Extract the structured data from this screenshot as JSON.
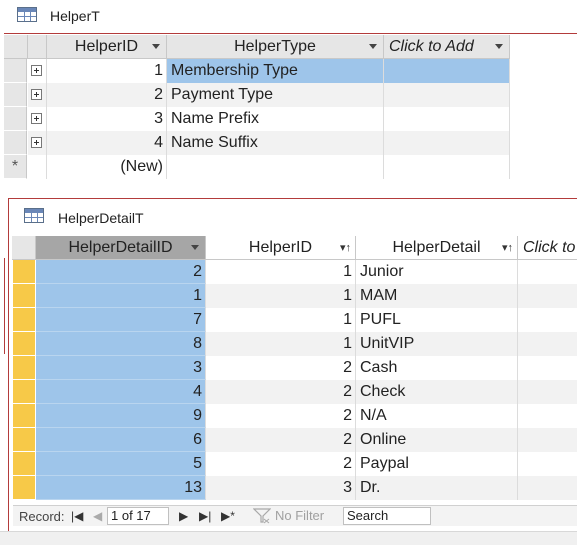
{
  "helperT": {
    "title": "HelperT",
    "columns": [
      "HelperID",
      "HelperType",
      "Click to Add"
    ],
    "rows": [
      {
        "id": "1",
        "type": "Membership Type"
      },
      {
        "id": "2",
        "type": "Payment Type"
      },
      {
        "id": "3",
        "type": "Name Prefix"
      },
      {
        "id": "4",
        "type": "Name Suffix"
      }
    ],
    "new_row_marker": "*",
    "new_row_label": "(New)"
  },
  "helperDetailT": {
    "title": "HelperDetailT",
    "columns": [
      "HelperDetailID",
      "HelperID",
      "HelperDetail",
      "Click to"
    ],
    "rows": [
      {
        "detail_id": "2",
        "helper_id": "1",
        "detail": "Junior"
      },
      {
        "detail_id": "1",
        "helper_id": "1",
        "detail": "MAM"
      },
      {
        "detail_id": "7",
        "helper_id": "1",
        "detail": "PUFL"
      },
      {
        "detail_id": "8",
        "helper_id": "1",
        "detail": "UnitVIP"
      },
      {
        "detail_id": "3",
        "helper_id": "2",
        "detail": "Cash"
      },
      {
        "detail_id": "4",
        "helper_id": "2",
        "detail": "Check"
      },
      {
        "detail_id": "9",
        "helper_id": "2",
        "detail": "N/A"
      },
      {
        "detail_id": "6",
        "helper_id": "2",
        "detail": "Online"
      },
      {
        "detail_id": "5",
        "helper_id": "2",
        "detail": "Paypal"
      },
      {
        "detail_id": "13",
        "helper_id": "3",
        "detail": "Dr."
      }
    ]
  },
  "navigator": {
    "record_label": "Record:",
    "first": "|◀",
    "prev": "◀",
    "position": "1 of 17",
    "next": "▶",
    "last": "▶|",
    "new": "▶*",
    "filter": "No Filter",
    "search_placeholder": "Search"
  },
  "colors": {
    "accent_border": "#b33b3b",
    "selected_cell": "#9ec5ea",
    "row_selector": "#f7c948",
    "header_gray": "#e6e6e6"
  }
}
